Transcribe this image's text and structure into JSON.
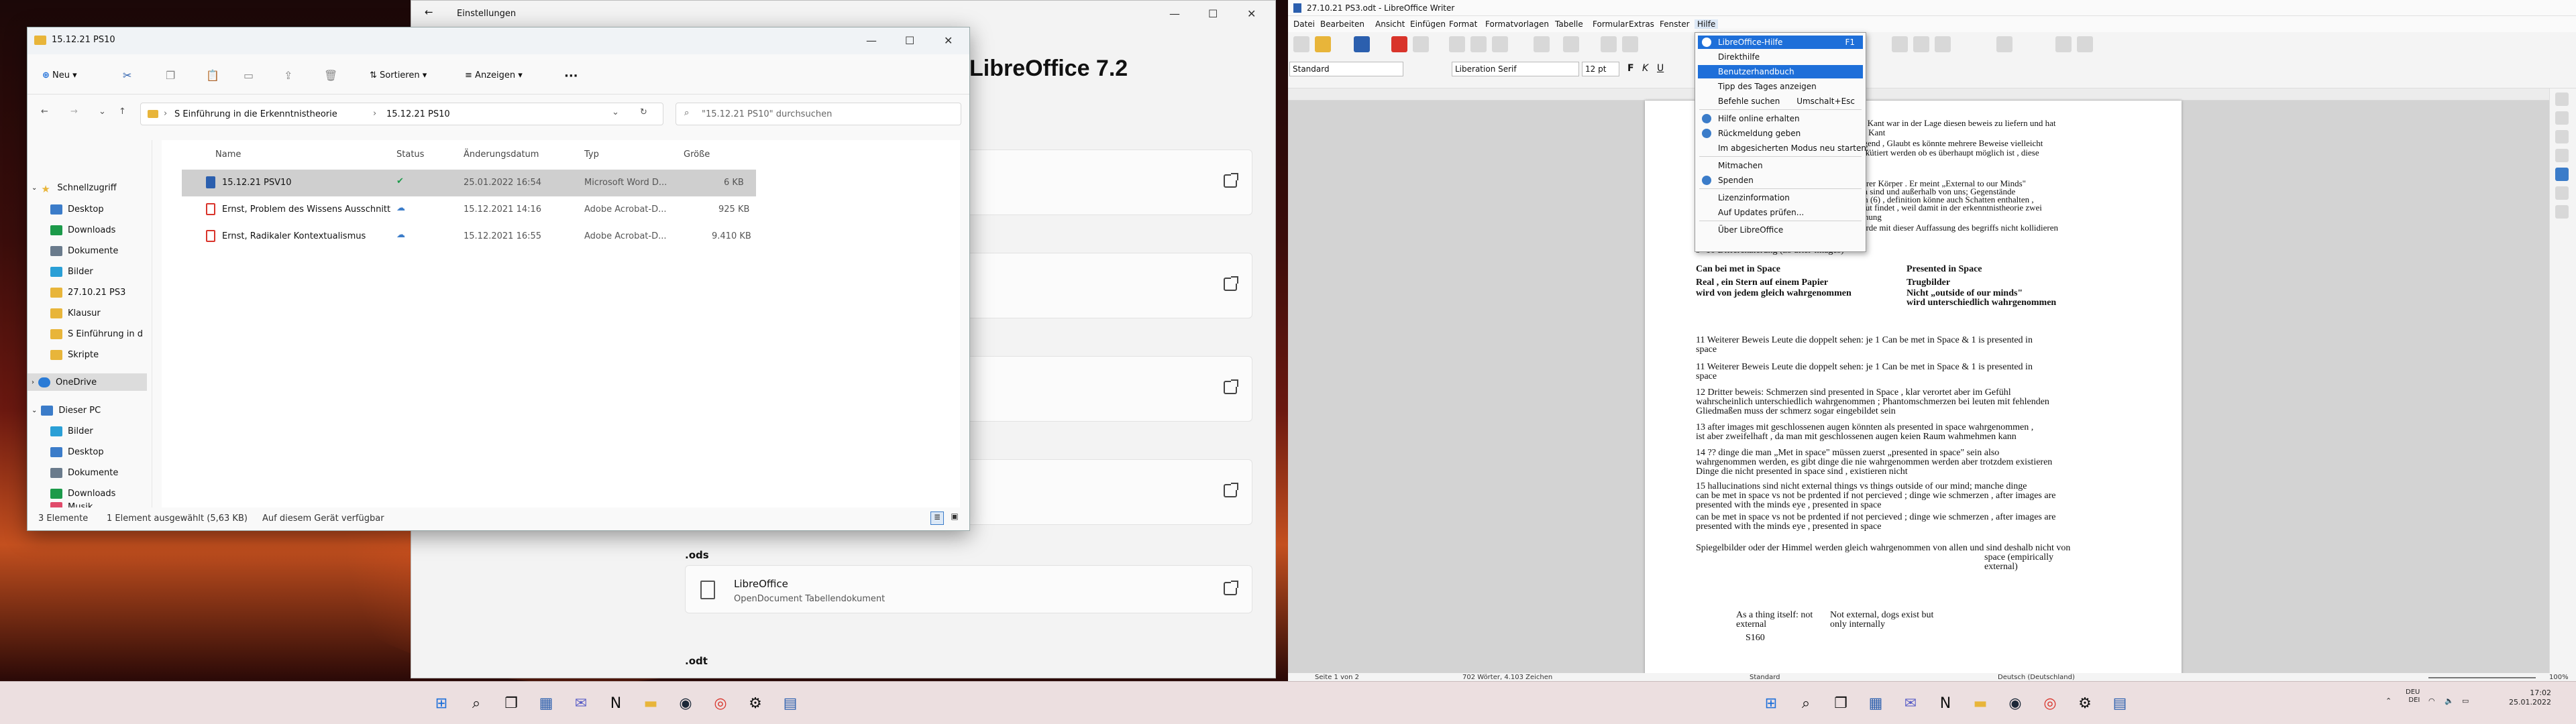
{
  "colors": {
    "accent": "#1e6fd9",
    "folder": "#e8b53a",
    "onedrive": "#2a7bd6",
    "pdf": "#d9342b",
    "word": "#2b5fae",
    "sync_ok": "#1c9a4a",
    "cloud": "#3b7cc9"
  },
  "settings": {
    "title": "Einstellungen",
    "heading": "LibreOffice 7.2",
    "section_ods": ".ods",
    "section_odt": ".odt",
    "app_name": "LibreOffice",
    "app_desc": "OpenDocument Tabellendokument"
  },
  "explorer": {
    "tab_title": "15.12.21 PS10",
    "toolbar": {
      "new": "Neu",
      "sort": "Sortieren",
      "view": "Anzeigen",
      "more": "···"
    },
    "breadcrumb": [
      "S Einführung in die Erkenntnistheorie",
      "15.12.21 PS10"
    ],
    "search_placeholder": "\"15.12.21 PS10\" durchsuchen",
    "columns": {
      "name": "Name",
      "status": "Status",
      "date": "Änderungsdatum",
      "type": "Typ",
      "size": "Größe"
    },
    "files": [
      {
        "name": "15.12.21 PSV10",
        "date": "25.01.2022 16:54",
        "type": "Microsoft Word D...",
        "size": "6 KB",
        "icon": "word-doc-icon",
        "status": "synced-check-icon"
      },
      {
        "name": "Ernst, Problem des Wissens Ausschnitt",
        "date": "15.12.2021 14:16",
        "type": "Adobe Acrobat-D...",
        "size": "925 KB",
        "icon": "pdf-icon",
        "status": "cloud-icon"
      },
      {
        "name": "Ernst, Radikaler Kontextualismus",
        "date": "15.12.2021 16:55",
        "type": "Adobe Acrobat-D...",
        "size": "9.410 KB",
        "icon": "pdf-icon",
        "status": "cloud-icon"
      }
    ],
    "nav": {
      "quick": "Schnellzugriff",
      "quick_items": [
        "Desktop",
        "Downloads",
        "Dokumente",
        "Bilder",
        "27.10.21 PS3",
        "Klausur",
        "S Einführung in d",
        "Skripte"
      ],
      "onedrive": "OneDrive",
      "pc": "Dieser PC",
      "pc_items": [
        "Bilder",
        "Desktop",
        "Dokumente",
        "Downloads",
        "Musik"
      ]
    },
    "status": {
      "count": "3 Elemente",
      "selected": "1 Element ausgewählt (5,63 KB)",
      "avail": "Auf diesem Gerät verfügbar"
    }
  },
  "writer": {
    "title": "27.10.21 PS3.odt - LibreOffice Writer",
    "menu": [
      "Datei",
      "Bearbeiten",
      "Ansicht",
      "Einfügen",
      "Format",
      "Formatvorlagen",
      "Tabelle",
      "Formular",
      "Extras",
      "Fenster",
      "Hilfe"
    ],
    "para_style": "Standard",
    "font": "Liberation Serif",
    "font_size": "12 pt",
    "help_menu": [
      {
        "label": "LibreOffice-Hilfe",
        "shortcut": "F1",
        "icon": "help-icon"
      },
      {
        "label": "Direkthilfe",
        "shortcut": ""
      },
      {
        "label": "Benutzerhandbuch",
        "shortcut": ""
      },
      {
        "label": "Tipp des Tages anzeigen",
        "shortcut": ""
      },
      {
        "label": "Befehle suchen",
        "shortcut": "Umschalt+Esc"
      },
      {
        "label": "Hilfe online erhalten",
        "shortcut": "",
        "icon": "globe-icon"
      },
      {
        "label": "Rückmeldung geben",
        "shortcut": "",
        "icon": "feedback-icon"
      },
      {
        "label": "Im abgesicherten Modus neu starten...",
        "shortcut": ""
      },
      {
        "label": "Mitmachen",
        "shortcut": ""
      },
      {
        "label": "Spenden",
        "shortcut": "",
        "icon": "donate-icon"
      },
      {
        "label": "Lizenzinformation",
        "shortcut": ""
      },
      {
        "label": "Auf Updates prüfen...",
        "shortcut": ""
      },
      {
        "label": "Über LibreOffice",
        "shortcut": ""
      }
    ],
    "doc_lines": [
      "ollo",
      "hen; Kant war in der Lage diesen beweis zu liefern und hat",
      "Laut Kant",
      "iedigend , Glaubt es könnte mehrere Beweise vielleicht",
      "r diskutiert werden ob es überhaupt möglich ist , diese",
      "unserer Körper . Er meint „External to our Minds\"",
      "nlich sind und außerhalb von uns; Gegenstände",
      "ktion (6) , definition könne auch Schatten enthalten ,",
      "er Gut findet , weil damit in der erkenntnistheorie zwei",
      "eziehung",
      ") würde mit dieser Auffassung des begriffs nicht kollidieren",
      "er möchte es weiter untersuchen",
      "9+10          Differenzierung  (zb after-images)",
      "Can bei met in Space",
      "Presented in Space",
      "Real , ein Stern auf einem Papier",
      "Trugbilder",
      "wird von jedem gleich wahrgenommen",
      "Nicht „outside of our minds\"",
      "wird unterschiedlich wahrgenommen",
      "11          Weiterer Beweis Leute die doppelt sehen:  je 1 Can be met in Space & 1 is presented in",
      "space",
      "11          Weiterer Beweis Leute die doppelt sehen:  je 1 Can be met in Space & 1 is presented in",
      "space",
      "12          Dritter beweis: Schmerzen sind presented in Space , klar verortet aber im Gefühl",
      "wahrscheinlich unterschiedlich wahrgenommen ; Phantomschmerzen bei leuten mit fehlenden",
      "Gliedmaßen muss der schmerz sogar eingebildet sein",
      "13          after images mit geschlossenen augen könnten als presented in space wahrgenommen ,",
      "ist aber zweifelhaft , da man mit geschlossenen augen keien Raum wahmehmen kann",
      "14 ??        dinge die man „Met in space\" müssen zuerst „presented in space\" sein also",
      "wahrgenommen werden, es gibt dinge die nie wahrgenommen werden aber trotzdem existieren",
      "Dinge die nicht presented in space sind , existieren nicht",
      "15          hallucinations sind nicht external things vs things outside of our mind; manche dinge",
      "can be met in space vs not be prdented if not percieved ; dinge wie schmerzen , after images are",
      "presented with the minds eye , presented in space",
      "can be met in space vs not be prdented if not percieved ; dinge wie schmerzen , after images are",
      "presented with the minds eye , presented in space",
      "Spiegelbilder oder der Himmel werden gleich wahrgenommen von allen und sind deshalb nicht von",
      "space (empirically",
      "external)",
      "As a thing itself: not",
      "Not external, dogs exist but",
      "external",
      "only internally",
      "S160"
    ],
    "status": {
      "page": "Seite 1 von 2",
      "words": "702 Wörter, 4.103 Zeichen",
      "style": "Standard",
      "lang": "Deutsch (Deutschland)",
      "zoom": "100%"
    }
  },
  "taskbar": {
    "lang": "DEU",
    "lang2": "DEI",
    "time": "17:02",
    "date": "25.01.2022"
  }
}
